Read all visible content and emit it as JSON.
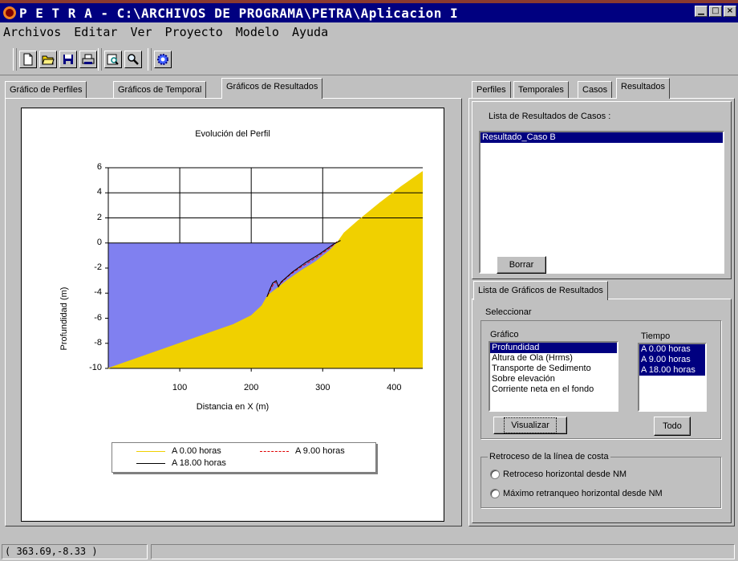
{
  "window": {
    "title": "P E T R A - C:\\ARCHIVOS DE PROGRAMA\\PETRA\\Aplicacion I",
    "controls": [
      "minimize",
      "maximize",
      "close"
    ]
  },
  "menu": [
    "Archivos",
    "Editar",
    "Ver",
    "Proyecto",
    "Modelo",
    "Ayuda"
  ],
  "toolbar": {
    "icons": [
      "new-file-icon",
      "open-folder-icon",
      "save-icon",
      "print-icon",
      "print-preview-icon",
      "zoom-icon",
      "settings-gear-icon"
    ]
  },
  "left_tabs": [
    "Gráfico de Perfiles",
    "Gráficos de Temporal",
    "Gráficos de Resultados"
  ],
  "left_active_tab": "Gráficos de Resultados",
  "chart_data": {
    "type": "area",
    "title": "Evolución del Perfil",
    "xlabel": "Distancia en X (m)",
    "ylabel": "Profundidad (m)",
    "xlim": [
      0,
      440
    ],
    "ylim": [
      -10,
      6
    ],
    "xticks": [
      100,
      200,
      300,
      400
    ],
    "yticks": [
      6,
      4,
      2,
      0,
      -2,
      -4,
      -6,
      -8,
      -10
    ],
    "grid": "above-zero",
    "water_level": 0,
    "water_color": "#8080f0",
    "sand_color": "#f0d000",
    "legend_position": "bottom",
    "series": [
      {
        "name": "A 0.00 horas",
        "color": "#f0d000",
        "style": "solid",
        "x": [
          0,
          50,
          100,
          150,
          175,
          200,
          215,
          223,
          232,
          250,
          270,
          290,
          310,
          320,
          330,
          350,
          380,
          410,
          440
        ],
        "y": [
          -10,
          -9,
          -8,
          -7,
          -6.5,
          -5.8,
          -5,
          -4.2,
          -3.8,
          -3,
          -2.2,
          -1.5,
          -0.6,
          0,
          0.8,
          1.8,
          3.2,
          4.5,
          5.7
        ]
      },
      {
        "name": "A 9.00 horas",
        "color": "#e00000",
        "style": "dashed",
        "x": [
          223,
          228,
          233,
          238,
          245,
          255,
          270,
          290,
          310,
          320
        ],
        "y": [
          -4.2,
          -3.6,
          -3.1,
          -3.4,
          -3.0,
          -2.5,
          -1.9,
          -1.2,
          -0.4,
          0.1
        ]
      },
      {
        "name": "A 18.00 horas",
        "color": "#000000",
        "style": "solid",
        "x": [
          222,
          226,
          230,
          235,
          238,
          242,
          248,
          258,
          275,
          295,
          315,
          325
        ],
        "y": [
          -4.3,
          -3.7,
          -3.2,
          -3.0,
          -3.5,
          -3.1,
          -2.8,
          -2.3,
          -1.6,
          -0.9,
          -0.1,
          0.2
        ]
      }
    ]
  },
  "right_tabs": [
    "Perfiles",
    "Temporales",
    "Casos",
    "Resultados"
  ],
  "right_active_tab": "Resultados",
  "results": {
    "list_label": "Lista de Resultados de Casos :",
    "items": [
      "Resultado_Caso B"
    ],
    "delete_button": "Borrar"
  },
  "graphs_tab": "Lista de Gráficos de Resultados",
  "graphs": {
    "select_label": "Seleccionar",
    "graph_label": "Gráfico",
    "graph_items": [
      "Profundidad",
      "Altura de Ola (Hrms)",
      "Transporte de Sedimento",
      "Sobre elevación",
      "Corriente neta en el fondo"
    ],
    "time_label": "Tiempo",
    "time_items": [
      "A 0.00 horas",
      "A 9.00 horas",
      "A 18.00 horas"
    ],
    "visualize_button": "Visualizar",
    "all_button": "Todo"
  },
  "shoreline": {
    "label": "Retroceso de la línea de costa",
    "options": [
      "Retroceso horizontal desde NM",
      "Máximo retranqueo horizontal desde NM"
    ]
  },
  "status": {
    "coords": "( 363.69,-8.33 )"
  }
}
